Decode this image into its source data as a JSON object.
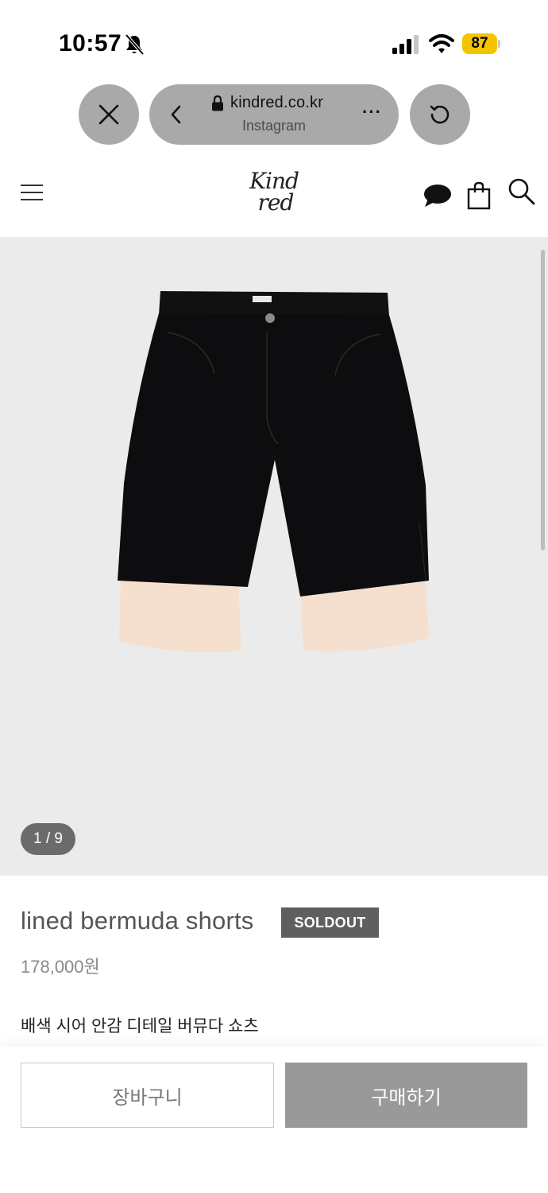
{
  "status_bar": {
    "time": "10:57",
    "battery": "87",
    "icons": [
      "bell-slash-icon",
      "cellular-signal-icon",
      "wifi-icon",
      "battery-icon"
    ]
  },
  "browser": {
    "domain": "kindred.co.kr",
    "source": "Instagram",
    "more": "···",
    "icons": [
      "close-icon",
      "chevron-left-icon",
      "lock-icon",
      "reload-icon"
    ]
  },
  "site_header": {
    "logo_line1": "Kind",
    "logo_line2": "red",
    "icons": [
      "menu-icon",
      "chat-icon",
      "shopping-bag-icon",
      "search-icon"
    ]
  },
  "gallery": {
    "counter": "1 / 9",
    "image": "black bermuda shorts with sheer beige lined hem"
  },
  "product": {
    "title": "lined bermuda shorts",
    "status_badge": "SOLDOUT",
    "price": "178,000원",
    "description": "배색 시어 안감 디테일 버뮤다 쇼츠"
  },
  "actions": {
    "cart_label": "장바구니",
    "buy_label": "구매하기"
  },
  "colors": {
    "battery": "#f5c400",
    "pill_bg": "#a9a9a9",
    "gallery_bg": "#ebebeb",
    "soldout_bg": "#5f5f5f",
    "buy_bg": "#999999"
  }
}
